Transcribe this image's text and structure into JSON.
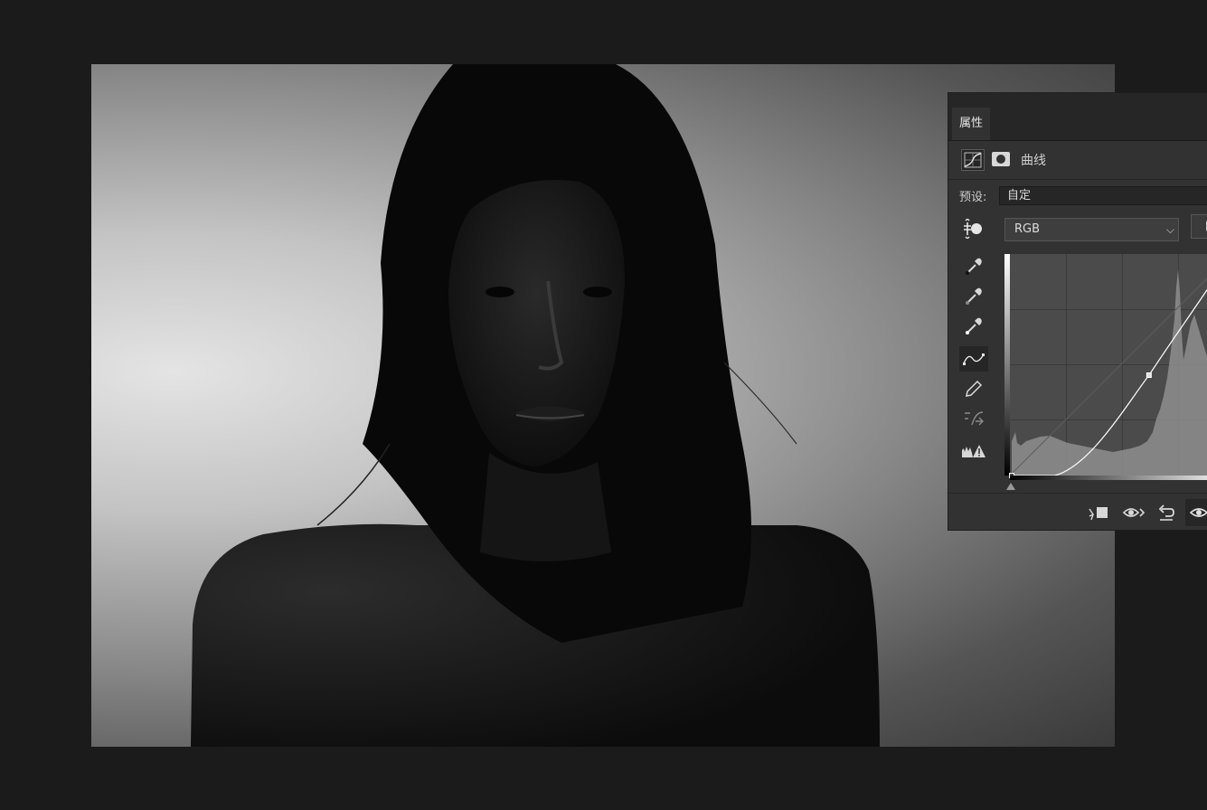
{
  "panel": {
    "tab_label": "属性",
    "title": "曲线",
    "preset_label": "预设:",
    "preset_value": "自定",
    "channel_value": "RGB",
    "auto_label": "自"
  },
  "icons": {
    "header": [
      "curves-adjustment-icon",
      "layer-mask-icon"
    ],
    "tools": [
      "on-image-adjust-icon",
      "black-point-eyedropper-icon",
      "gray-point-eyedropper-icon",
      "white-point-eyedropper-icon",
      "edit-curve-points-icon",
      "draw-pencil-icon",
      "smooth-curve-icon",
      "clipping-warning-icon"
    ],
    "footer": [
      "clip-to-layer-icon",
      "view-previous-state-icon",
      "reset-icon",
      "visibility-eye-icon"
    ]
  },
  "curve": {
    "points": [
      [
        0,
        0
      ],
      [
        50,
        0
      ],
      [
        160,
        116
      ],
      [
        255,
        255
      ]
    ]
  },
  "colors": {
    "panel_bg": "#323232",
    "workspace_bg": "#1b1b1b",
    "graph_bg": "#4b4b4b",
    "histogram": "#8e8e8e",
    "curve": "#ffffff"
  }
}
